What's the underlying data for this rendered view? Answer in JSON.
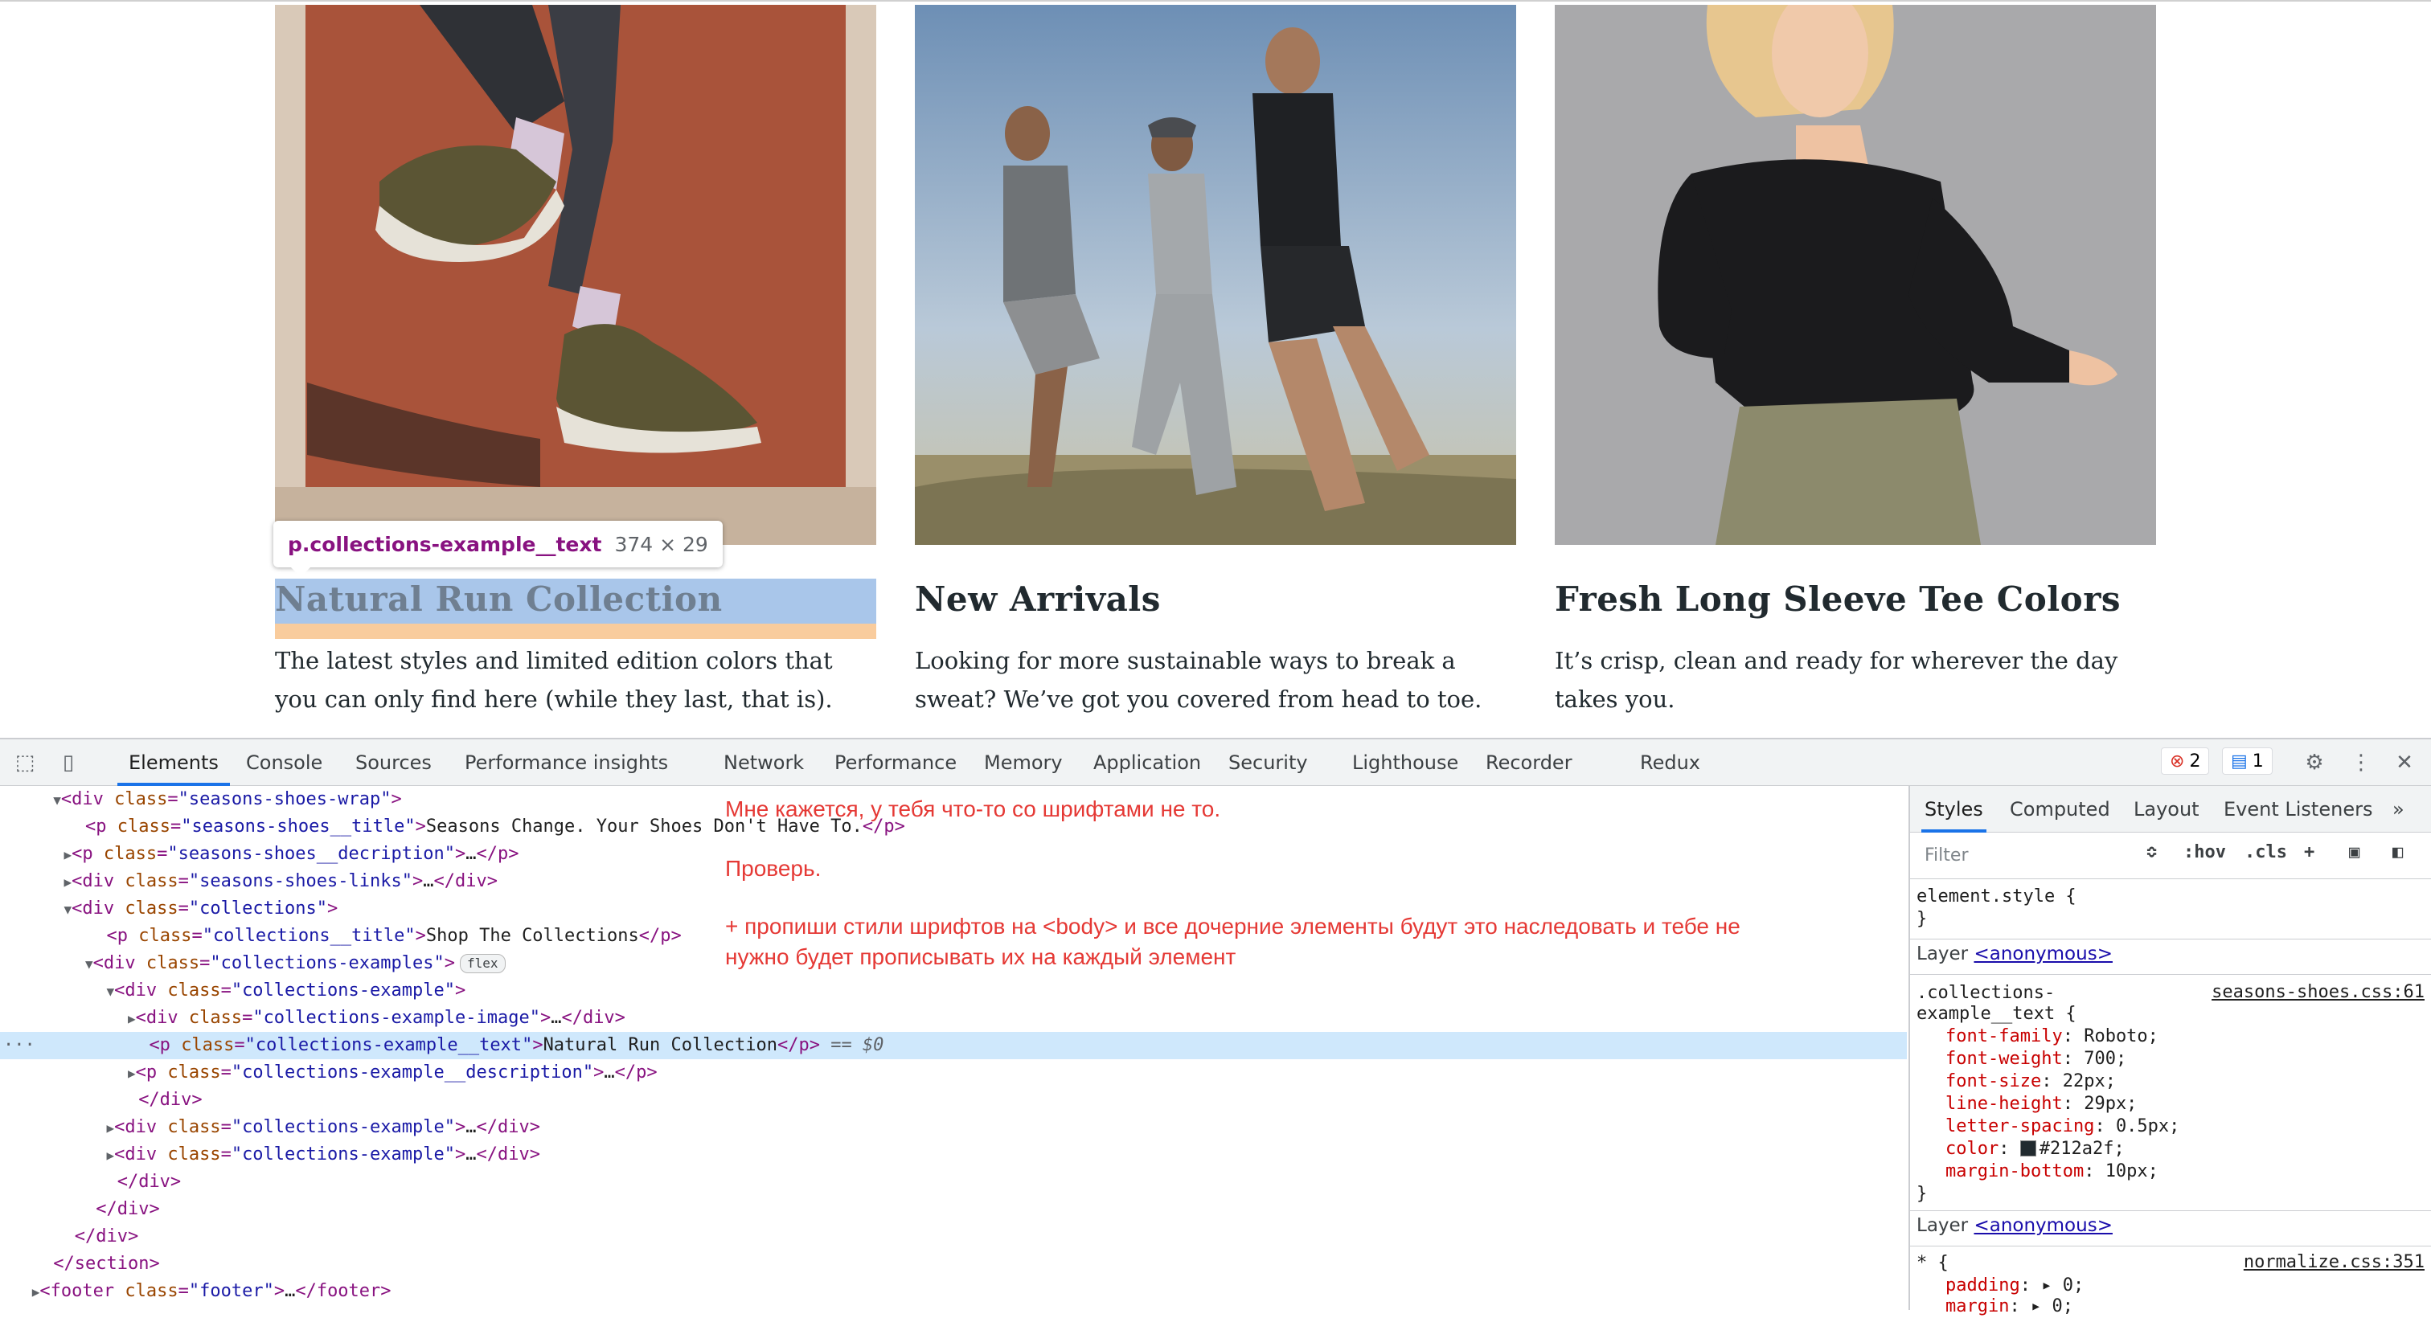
{
  "page": {
    "cards": [
      {
        "title": "Natural Run Collection",
        "description": "The latest styles and limited edition colors that you can only find here (while they last, that is)."
      },
      {
        "title": "New Arrivals",
        "description": "Looking for more sustainable ways to break a sweat? We’ve got you covered from head to toe."
      },
      {
        "title": "Fresh Long Sleeve Tee Colors",
        "description": "It’s crisp, clean and ready for wherever the day takes you."
      }
    ],
    "inspect_tooltip": {
      "selector": "p.collections-example__text",
      "size": "374 × 29"
    }
  },
  "devtools": {
    "tabs": [
      "Elements",
      "Console",
      "Sources",
      "Performance insights",
      "Network",
      "Performance",
      "Memory",
      "Application",
      "Security",
      "Lighthouse",
      "Recorder",
      "Redux"
    ],
    "active_tab": "Elements",
    "errors_count": "2",
    "messages_count": "1",
    "dom_lines": [
      {
        "tag": "div",
        "class": "seasons-shoes-wrap",
        "tail": ">"
      },
      {
        "tag": "p",
        "class": "seasons-shoes__title",
        "text": "Seasons Change. Your Shoes Don't Have To.",
        "close": "</p>"
      },
      {
        "tag": "p",
        "class": "seasons-shoes__decription",
        "collapsed": "…</p>"
      },
      {
        "tag": "div",
        "class": "seasons-shoes-links",
        "collapsed": "…</div>"
      },
      {
        "tag": "div",
        "class": "collections",
        "tail": ">"
      },
      {
        "tag": "p",
        "class": "collections__title",
        "text": "Shop The Collections",
        "close": "</p>"
      },
      {
        "tag": "div",
        "class": "collections-examples",
        "tail": ">",
        "badge": "flex"
      },
      {
        "tag": "div",
        "class": "collections-example",
        "tail": ">"
      },
      {
        "tag": "div",
        "class": "collections-example-image",
        "collapsed": "…</div>"
      },
      {
        "tag": "p",
        "class": "collections-example__text",
        "text": "Natural Run Collection",
        "close": "</p>",
        "eq": "== $0"
      },
      {
        "tag": "p",
        "class": "collections-example__description",
        "collapsed": "…</p>"
      },
      {
        "close_only": "</div>"
      },
      {
        "tag": "div",
        "class": "collections-example",
        "collapsed": "…</div>"
      },
      {
        "tag": "div",
        "class": "collections-example",
        "collapsed": "…</div>"
      },
      {
        "close_only": "</div>"
      },
      {
        "close_only": "</div>"
      },
      {
        "close_only": "</div>"
      },
      {
        "close_only": "</section>"
      },
      {
        "tag": "footer",
        "class": "footer",
        "collapsed": "…</footer>"
      }
    ],
    "notes": [
      "Мне кажется, у тебя что-то со шрифтами не то.",
      "Проверь.",
      "+ пропиши стили шрифтов на <body> и все дочерние элементы будут это наследовать и тебе не",
      "нужно будет прописывать их на каждый элемент"
    ],
    "styles_pane": {
      "tabs": [
        "Styles",
        "Computed",
        "Layout",
        "Event Listeners"
      ],
      "filter_placeholder": "Filter",
      "hov": ":hov",
      "cls": ".cls",
      "element_style": "element.style {",
      "close_brace": "}",
      "layer_label": "Layer",
      "layer_name": "<anonymous>",
      "rule1": {
        "selector_line1": ".collections-",
        "selector_line2": "example__text {",
        "source": "seasons-shoes.css:61",
        "props": [
          [
            "font-family",
            "Roboto;"
          ],
          [
            "font-weight",
            "700;"
          ],
          [
            "font-size",
            "22px;"
          ],
          [
            "line-height",
            "29px;"
          ],
          [
            "letter-spacing",
            "0.5px;"
          ],
          [
            "color",
            "#212a2f;"
          ],
          [
            "margin-bottom",
            "10px;"
          ]
        ]
      },
      "rule2": {
        "selector": "* {",
        "source": "normalize.css:351",
        "props": [
          [
            "padding",
            "0;"
          ],
          [
            "margin",
            "0;"
          ]
        ]
      }
    }
  }
}
